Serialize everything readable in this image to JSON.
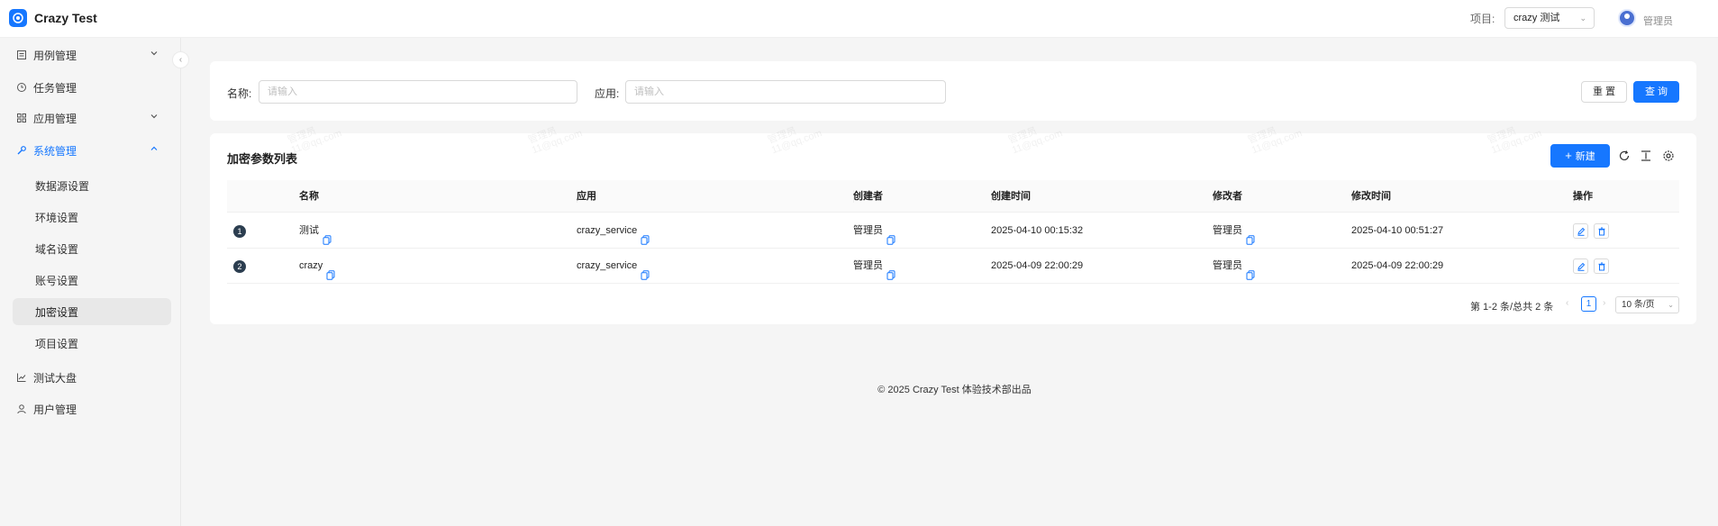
{
  "header": {
    "app_title": "Crazy Test",
    "project_label": "项目:",
    "project_value": "crazy 测试",
    "user_name": "管理员"
  },
  "sidebar": {
    "items": [
      {
        "label": "用例管理",
        "icon": "case-icon",
        "expandable": true
      },
      {
        "label": "任务管理",
        "icon": "clock-icon",
        "expandable": false
      },
      {
        "label": "应用管理",
        "icon": "grid-icon",
        "expandable": true
      },
      {
        "label": "系统管理",
        "icon": "wrench-icon",
        "expandable": true,
        "expanded": true
      },
      {
        "label": "测试大盘",
        "icon": "chart-icon",
        "expandable": false
      },
      {
        "label": "用户管理",
        "icon": "user-icon",
        "expandable": false
      }
    ],
    "sub_items": [
      "数据源设置",
      "环境设置",
      "域名设置",
      "账号设置",
      "加密设置",
      "项目设置"
    ],
    "selected_sub": "加密设置"
  },
  "search": {
    "name_label": "名称:",
    "name_placeholder": "请输入",
    "app_label": "应用:",
    "app_placeholder": "请输入",
    "reset_label": "重 置",
    "query_label": "查 询"
  },
  "table": {
    "title": "加密参数列表",
    "new_label": "新建",
    "columns": [
      "名称",
      "应用",
      "创建者",
      "创建时间",
      "修改者",
      "修改时间",
      "操作"
    ],
    "rows": [
      {
        "index": "1",
        "name": "测试",
        "app": "crazy_service",
        "creator": "管理员",
        "created": "2025-04-10 00:15:32",
        "modifier": "管理员",
        "modified": "2025-04-10 00:51:27"
      },
      {
        "index": "2",
        "name": "crazy",
        "app": "crazy_service",
        "creator": "管理员",
        "created": "2025-04-09 22:00:29",
        "modifier": "管理员",
        "modified": "2025-04-09 22:00:29"
      }
    ]
  },
  "pagination": {
    "total_text": "第 1-2 条/总共 2 条",
    "current_page": "1",
    "page_size": "10 条/页"
  },
  "footer": {
    "text": "© 2025 Crazy Test 体验技术部出品"
  },
  "watermark": {
    "line1": "管理员",
    "line2": "11@qq.com"
  },
  "colors": {
    "primary": "#1677ff",
    "sidebar_selected_bg": "#e8e8e8",
    "page_bg": "#f5f5f5"
  }
}
